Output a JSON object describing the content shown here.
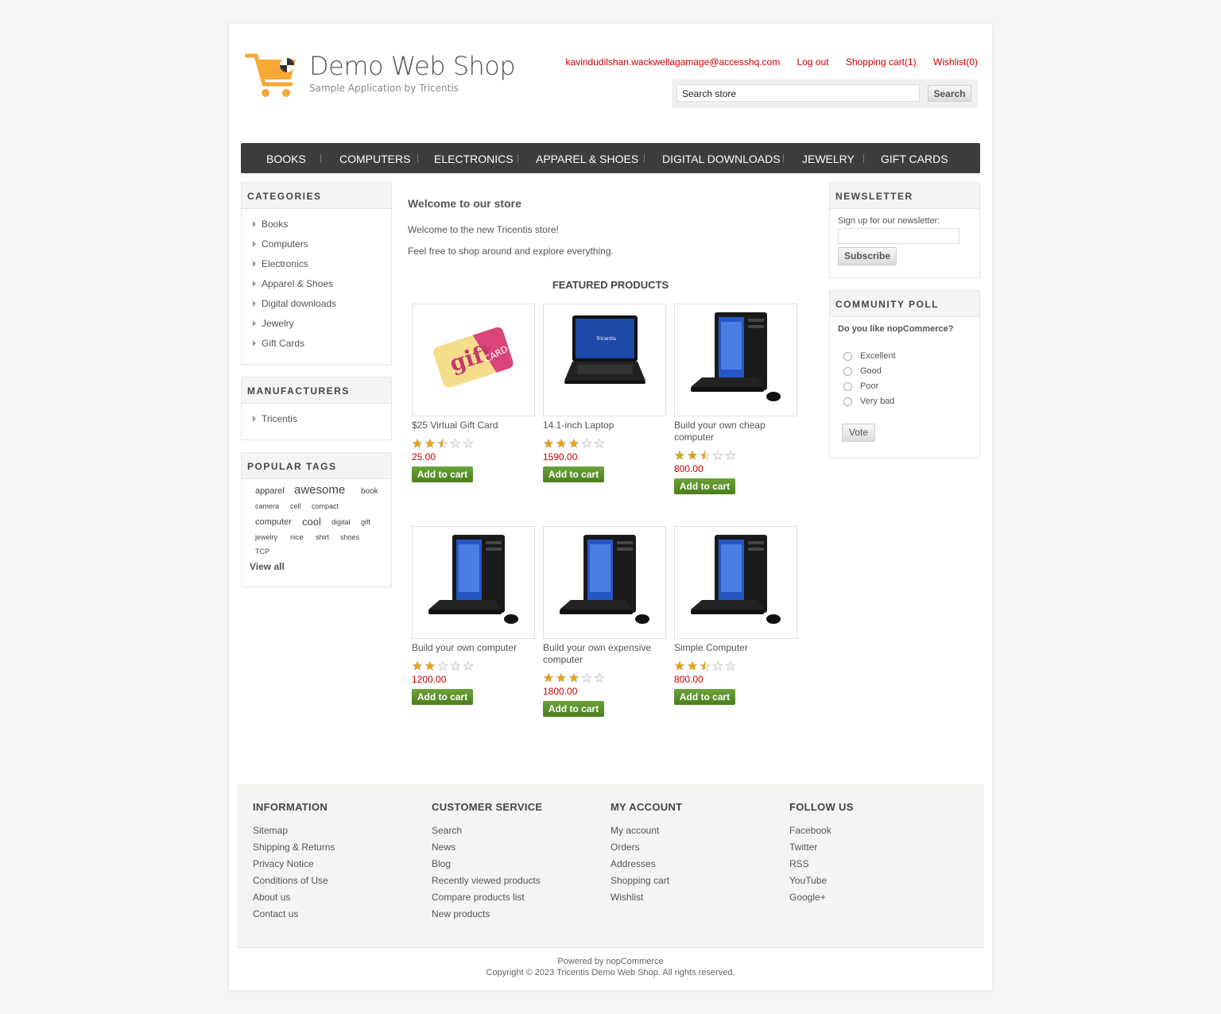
{
  "header": {
    "logo_title": "Demo Web Shop",
    "logo_subtitle": "Sample Application by Tricentis",
    "account_email": "kavindudilshan.wackwellagamage@accesshq.com",
    "logout": "Log out",
    "cart": "Shopping cart(1)",
    "wishlist": "Wishlist(0)",
    "search_placeholder": "Search store",
    "search_button": "Search",
    "accent_color": "#cc0000",
    "logo_color": "#f7a836"
  },
  "nav": [
    "BOOKS",
    "COMPUTERS",
    "ELECTRONICS",
    "APPAREL & SHOES",
    "DIGITAL DOWNLOADS",
    "JEWELRY",
    "GIFT CARDS"
  ],
  "categories": {
    "title": "CATEGORIES",
    "items": [
      "Books",
      "Computers",
      "Electronics",
      "Apparel & Shoes",
      "Digital downloads",
      "Jewelry",
      "Gift Cards"
    ]
  },
  "manufacturers": {
    "title": "MANUFACTURERS",
    "items": [
      "Tricentis"
    ]
  },
  "popular_tags": {
    "title": "POPULAR TAGS",
    "tags": [
      "apparel",
      "awesome",
      "book",
      "camera",
      "cell",
      "compact",
      "computer",
      "cool",
      "digital",
      "gift",
      "jewelry",
      "nice",
      "shirt",
      "shoes",
      "TCP"
    ],
    "view_all": "View all"
  },
  "welcome": {
    "title": "Welcome to our store",
    "line1": "Welcome to the new Tricentis store!",
    "line2": "Feel free to shop around and explore everything."
  },
  "featured": {
    "title": "FEATURED PRODUCTS",
    "add_to_cart": "Add to cart",
    "products": [
      {
        "title": "$25 Virtual Gift Card",
        "price": "25.00",
        "rating": 2.5,
        "image": "gift-card"
      },
      {
        "title": "14.1-inch Laptop",
        "price": "1590.00",
        "rating": 3,
        "image": "laptop"
      },
      {
        "title": "Build your own cheap computer",
        "price": "800.00",
        "rating": 2.5,
        "image": "desktop"
      },
      {
        "title": "Build your own computer",
        "price": "1200.00",
        "rating": 2,
        "image": "desktop"
      },
      {
        "title": "Build your own expensive computer",
        "price": "1800.00",
        "rating": 3,
        "image": "desktop"
      },
      {
        "title": "Simple Computer",
        "price": "800.00",
        "rating": 2.5,
        "image": "desktop"
      }
    ]
  },
  "newsletter": {
    "title": "NEWSLETTER",
    "label": "Sign up for our newsletter:",
    "button": "Subscribe"
  },
  "poll": {
    "title": "COMMUNITY POLL",
    "question": "Do you like nopCommerce?",
    "options": [
      "Excellent",
      "Good",
      "Poor",
      "Very bad"
    ],
    "button": "Vote"
  },
  "footer": {
    "columns": [
      {
        "title": "INFORMATION",
        "links": [
          "Sitemap",
          "Shipping & Returns",
          "Privacy Notice",
          "Conditions of Use",
          "About us",
          "Contact us"
        ]
      },
      {
        "title": "CUSTOMER SERVICE",
        "links": [
          "Search",
          "News",
          "Blog",
          "Recently viewed products",
          "Compare products list",
          "New products"
        ]
      },
      {
        "title": "MY ACCOUNT",
        "links": [
          "My account",
          "Orders",
          "Addresses",
          "Shopping cart",
          "Wishlist"
        ]
      },
      {
        "title": "FOLLOW US",
        "links": [
          "Facebook",
          "Twitter",
          "RSS",
          "YouTube",
          "Google+"
        ]
      }
    ],
    "powered": "Powered by nopCommerce",
    "copyright": "Copyright © 2023 Tricentis Demo Web Shop. All rights reserved."
  }
}
